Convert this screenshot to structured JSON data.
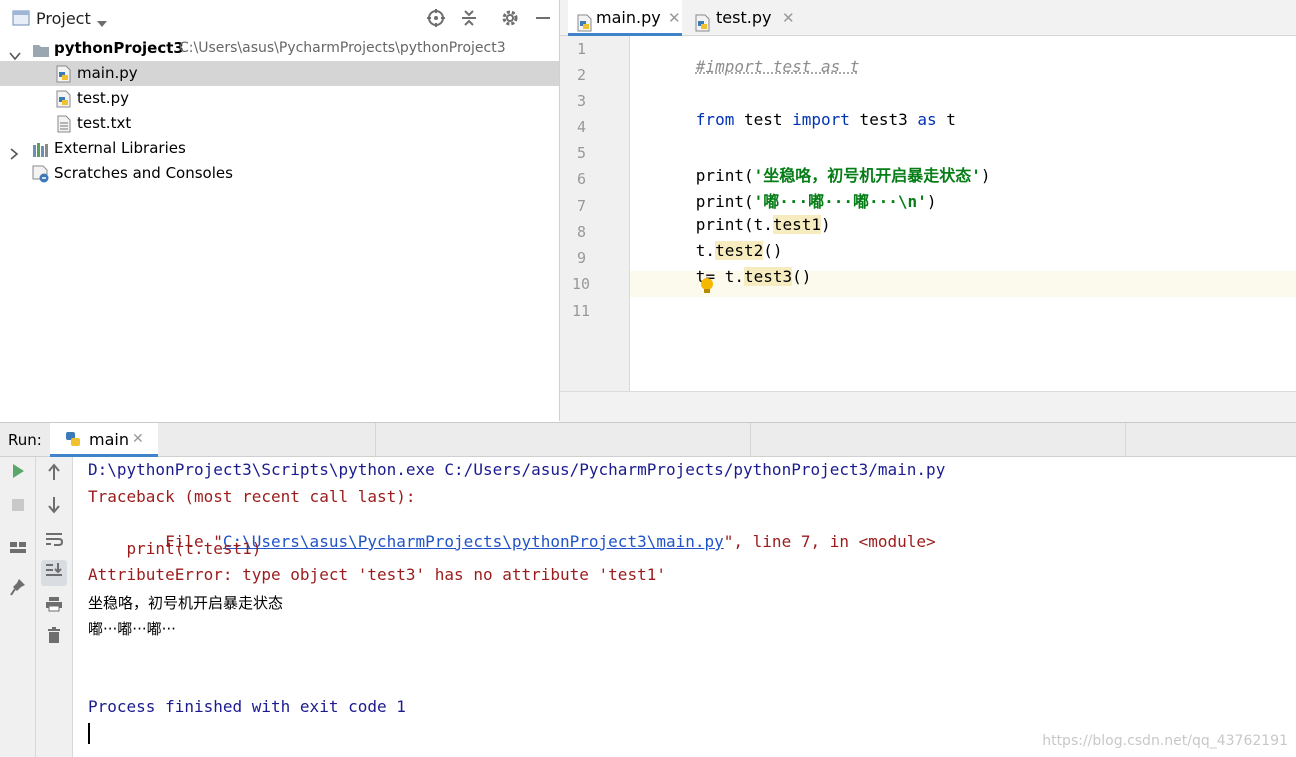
{
  "project_panel": {
    "title": "Project",
    "tree": [
      {
        "label": "pythonProject3",
        "hint": "C:\\Users\\asus\\PycharmProjects\\pythonProject3"
      },
      {
        "label": "main.py"
      },
      {
        "label": "test.py"
      },
      {
        "label": "test.txt"
      },
      {
        "label": "External Libraries"
      },
      {
        "label": "Scratches and Consoles"
      }
    ]
  },
  "editor": {
    "tabs": [
      {
        "label": "main.py"
      },
      {
        "label": "test.py"
      }
    ],
    "line_numbers": [
      "1",
      "2",
      "3",
      "4",
      "5",
      "6",
      "7",
      "8",
      "9",
      "10",
      "11"
    ],
    "code": {
      "l1": "#import test as t",
      "l3_kw1": "from",
      "l3_mod": " test ",
      "l3_kw2": "import",
      "l3_name": " test3 ",
      "l3_kw3": "as",
      "l3_alias": " t",
      "l5_fn": "print(",
      "l5_str": "'坐稳咯，初号机开启暴走状态'",
      "l5_end": ")",
      "l6_fn": "print(",
      "l6_str": "'嘟···嘟···嘟···\\n'",
      "l6_end": ")",
      "l7_a": "print(t.",
      "l7_attr": "test1",
      "l7_b": ")",
      "l8_a": "t.",
      "l8_attr": "test2",
      "l8_b": "()",
      "l9_a": "t",
      "l9_b": "= t.",
      "l9_attr": "test3",
      "l9_c": "()"
    }
  },
  "run_panel": {
    "label": "Run:",
    "tab": "main",
    "console": {
      "cmd": "D:\\pythonProject3\\Scripts\\python.exe C:/Users/asus/PycharmProjects/pythonProject3/main.py",
      "traceback": "Traceback (most recent call last):",
      "file_prefix": "  File \"",
      "file_link": "C:\\Users\\asus\\PycharmProjects\\pythonProject3\\main.py",
      "file_suffix": "\", line 7, in <module>",
      "code_line": "    print(t.test1)",
      "error": "AttributeError: type object 'test3' has no attribute 'test1'",
      "out1": "坐稳咯，初号机开启暴走状态",
      "out2": "嘟···嘟···嘟···",
      "finished": "Process finished with exit code 1"
    }
  },
  "watermark": "https://blog.csdn.net/qq_43762191",
  "colors": {
    "keyword": "#0033b3",
    "string": "#067d17",
    "console_error": "#9b1c1c",
    "console_info": "#1b1b8f",
    "tab_underline": "#4083c9"
  }
}
